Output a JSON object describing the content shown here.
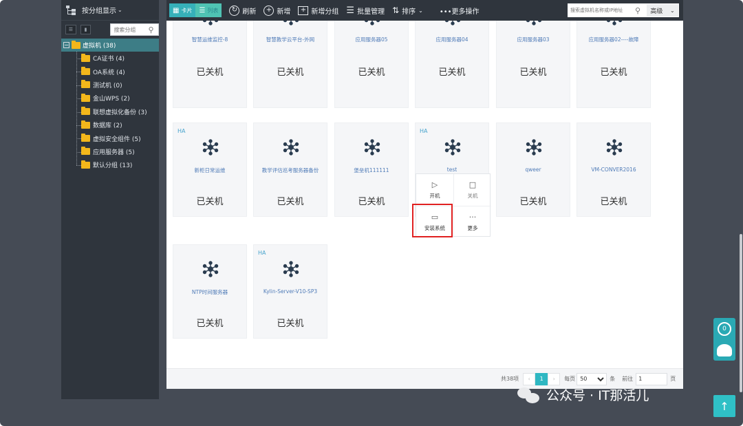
{
  "sidebar": {
    "group_display": "按分组显示",
    "tool1": "☰",
    "tool2": "▮",
    "search_placeholder": "搜索分组",
    "root": "虚拟机 (38)",
    "items": [
      {
        "label": "CA证书 (4)"
      },
      {
        "label": "OA系统 (4)"
      },
      {
        "label": "测试机 (0)"
      },
      {
        "label": "金山WPS (2)"
      },
      {
        "label": "联想虚拟化备份 (3)"
      },
      {
        "label": "数据库 (2)"
      },
      {
        "label": "虚拟安全组件 (5)"
      },
      {
        "label": "应用服务器 (5)"
      },
      {
        "label": "默认分组 (13)"
      }
    ]
  },
  "toolbar": {
    "card_view": "卡片",
    "list_view": "列表",
    "refresh": "刷新",
    "new": "新增",
    "new_group": "新增分组",
    "batch": "批量管理",
    "sort": "排序",
    "more_ops": "•••更多操作",
    "search_placeholder": "搜索虚拟机名称或IP地址",
    "advanced": "高级"
  },
  "vms": [
    {
      "name": "智慧运维监控-8",
      "state": "已关机",
      "ha": ""
    },
    {
      "name": "智慧教学云平台-外网",
      "state": "已关机",
      "ha": ""
    },
    {
      "name": "应用服务器05",
      "state": "已关机",
      "ha": ""
    },
    {
      "name": "应用服务器04",
      "state": "已关机",
      "ha": ""
    },
    {
      "name": "应用服务器03",
      "state": "已关机",
      "ha": ""
    },
    {
      "name": "应用服务器02----故障",
      "state": "已关机",
      "ha": ""
    },
    {
      "name": "新柜日常运维",
      "state": "已关机",
      "ha": "HA"
    },
    {
      "name": "教学评估巡考服务器备份",
      "state": "已关机",
      "ha": ""
    },
    {
      "name": "堡垒机111111",
      "state": "已关机",
      "ha": ""
    },
    {
      "name": "test",
      "state": "",
      "ha": "HA"
    },
    {
      "name": "qweer",
      "state": "已关机",
      "ha": ""
    },
    {
      "name": "VM-CONVER2016",
      "state": "已关机",
      "ha": ""
    },
    {
      "name": "NTP时间服务器",
      "state": "已关机",
      "ha": ""
    },
    {
      "name": "Kylin-Server-V10-SP3",
      "state": "已关机",
      "ha": "HA"
    }
  ],
  "popup": {
    "start": "开机",
    "shutdown": "关机",
    "install": "安装系统",
    "more": "更多"
  },
  "pager": {
    "total": "共38项",
    "page": "1",
    "per_page_label": "每页",
    "per_page": "50",
    "unit": "条",
    "goto_label": "前往",
    "goto_value": "1",
    "page_unit": "页"
  },
  "float": {
    "counter": "0"
  },
  "watermark": "公众号 · IT那活儿",
  "colors": {
    "accent": "#2fb7c2",
    "sidebar_bg": "#2f353d",
    "highlight": "#e02020",
    "folder": "#f3b71b"
  }
}
